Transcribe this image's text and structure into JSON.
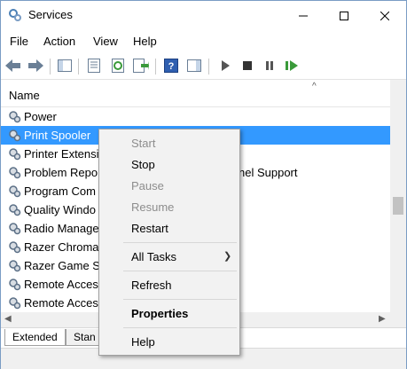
{
  "window": {
    "title": "Services"
  },
  "menubar": {
    "items": [
      "File",
      "Action",
      "View",
      "Help"
    ]
  },
  "list": {
    "header": {
      "name": "Name"
    },
    "rows": [
      {
        "name": "Power",
        "desc": ""
      },
      {
        "name": "Print Spooler",
        "desc": ""
      },
      {
        "name": "Printer Extensi",
        "desc": ""
      },
      {
        "name": "Problem Repo",
        "desc": "nel Support"
      },
      {
        "name": "Program Com",
        "desc": ""
      },
      {
        "name": "Quality Windo",
        "desc": ""
      },
      {
        "name": "Radio Manage",
        "desc": ""
      },
      {
        "name": "Razer Chroma",
        "desc": ""
      },
      {
        "name": "Razer Game Sc",
        "desc": ""
      },
      {
        "name": "Remote Acces",
        "desc": ""
      },
      {
        "name": "Remote Acces",
        "desc": ""
      }
    ],
    "selected_row": 1
  },
  "tabs": {
    "extended": "Extended",
    "standard": "Stan"
  },
  "context_menu": {
    "items": [
      {
        "label": "Start",
        "disabled": true
      },
      {
        "label": "Stop"
      },
      {
        "label": "Pause",
        "disabled": true
      },
      {
        "label": "Resume",
        "disabled": true
      },
      {
        "label": "Restart"
      },
      {
        "label": "All Tasks",
        "submenu": true
      },
      {
        "label": "Refresh"
      },
      {
        "label": "Properties",
        "bold": true
      },
      {
        "label": "Help"
      }
    ]
  },
  "colors": {
    "selection": "#3399ff",
    "title_icon": "#4a7fb5"
  }
}
